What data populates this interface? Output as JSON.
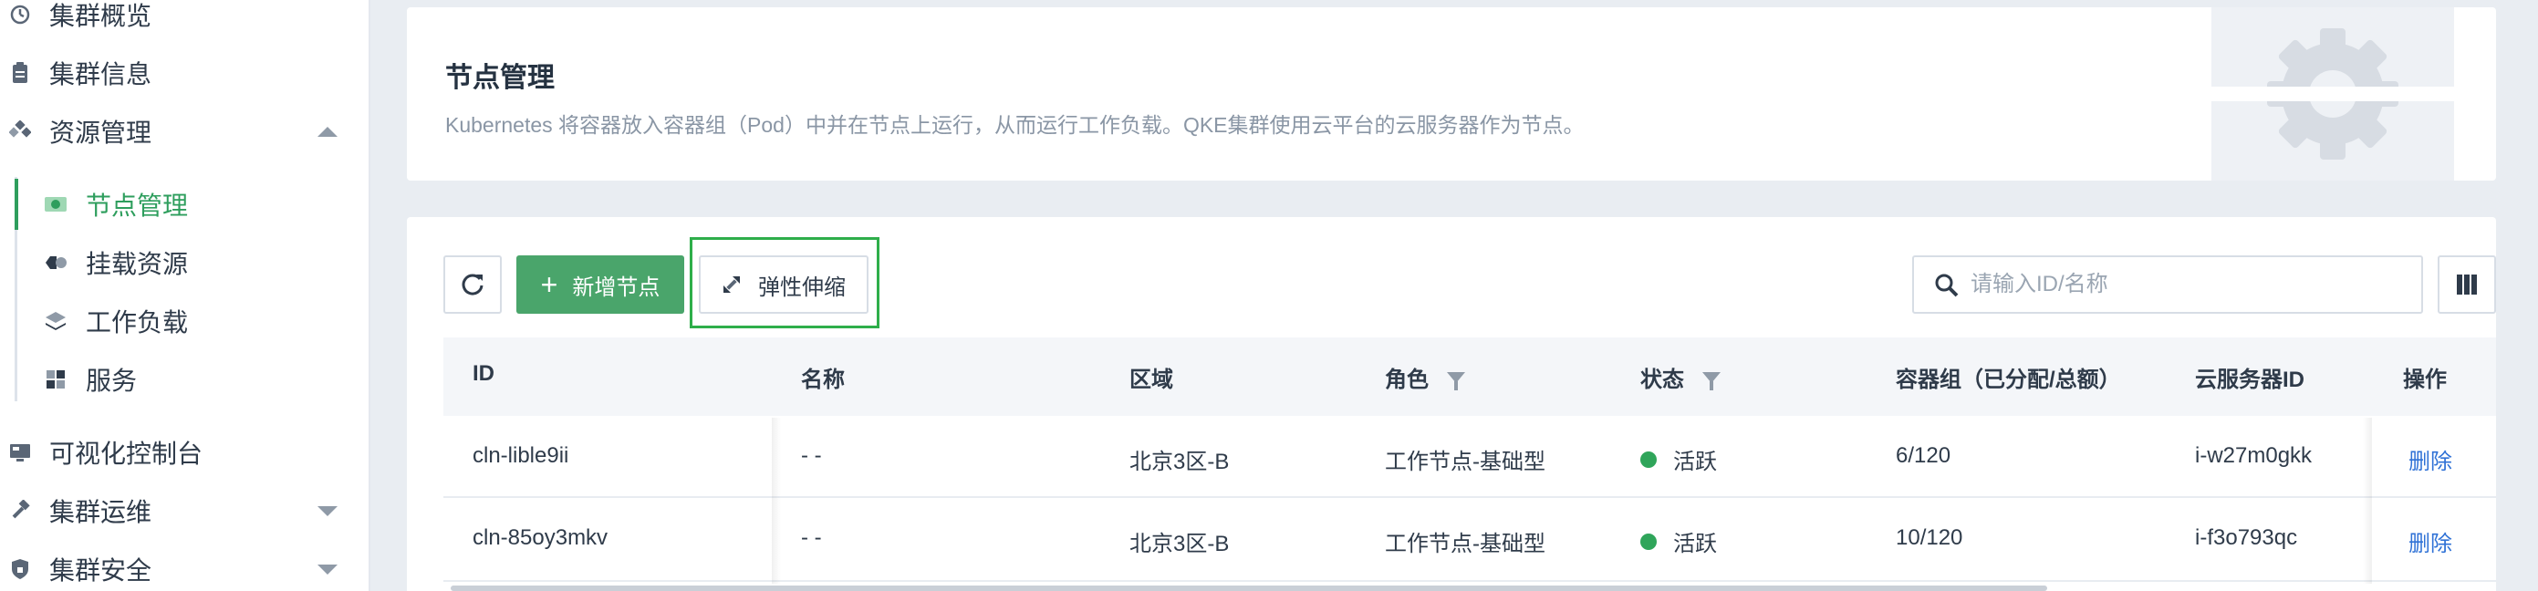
{
  "sidebar": {
    "items": [
      {
        "label": "集群概览",
        "icon": "dashboard-icon"
      },
      {
        "label": "集群信息",
        "icon": "clipboard-icon"
      },
      {
        "label": "资源管理",
        "icon": "resources-icon",
        "expanded": true
      },
      {
        "label": "可视化控制台",
        "icon": "monitor-icon"
      },
      {
        "label": "集群运维",
        "icon": "hammer-icon",
        "expanded": false
      },
      {
        "label": "集群安全",
        "icon": "shield-icon",
        "expanded": false
      }
    ],
    "resource_subitems": [
      {
        "label": "节点管理",
        "icon": "node-icon",
        "active": true
      },
      {
        "label": "挂载资源",
        "icon": "volume-icon"
      },
      {
        "label": "工作负载",
        "icon": "layers-icon"
      },
      {
        "label": "服务",
        "icon": "grid-icon"
      }
    ]
  },
  "header": {
    "title": "节点管理",
    "description": "Kubernetes 将容器放入容器组（Pod）中并在节点上运行，从而运行工作负载。QKE集群使用云平台的云服务器作为节点。",
    "hero_icon": "gear-icon"
  },
  "toolbar": {
    "refresh_icon": "refresh-icon",
    "add_label": "新增节点",
    "scale_label": "弹性伸缩",
    "scale_icon": "scale-icon",
    "search_placeholder": "请输入ID/名称",
    "search_value": "",
    "columns_icon": "columns-icon"
  },
  "table": {
    "columns": [
      "ID",
      "名称",
      "区域",
      "角色",
      "状态",
      "容器组（已分配/总额）",
      "云服务器ID",
      "操作"
    ],
    "rows": [
      {
        "id": "cln-lible9ii",
        "name": "- -",
        "zone": "北京3区-B",
        "role": "工作节点-基础型",
        "status": "活跃",
        "pods": "6/120",
        "instance": "i-w27m0gkk",
        "action": "删除"
      },
      {
        "id": "cln-85oy3mkv",
        "name": "- -",
        "zone": "北京3区-B",
        "role": "工作节点-基础型",
        "status": "活跃",
        "pods": "10/120",
        "instance": "i-f3o793qc",
        "action": "删除"
      }
    ]
  },
  "colors": {
    "accent": "#4aa56b",
    "active_text": "#2e9e5d",
    "status_active": "#2fa55a",
    "link": "#3072d6",
    "highlight_box": "#2eae4a"
  }
}
